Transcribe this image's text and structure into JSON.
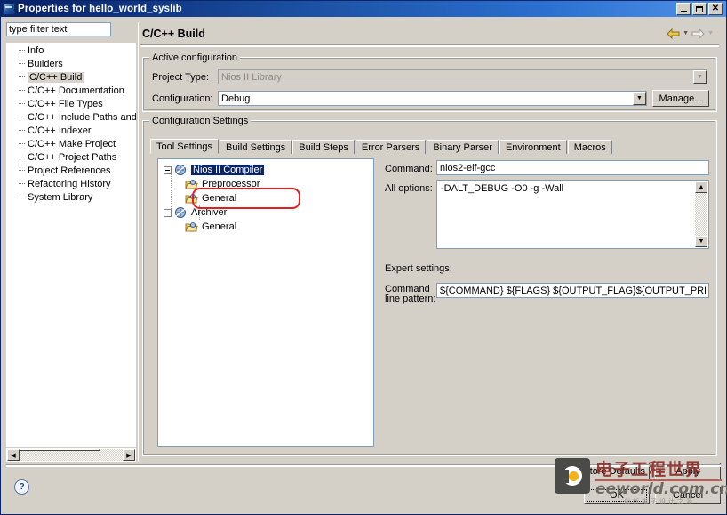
{
  "window": {
    "title": "Properties for hello_world_syslib",
    "icon": "properties-window-icon",
    "minimize": "_",
    "maximize": "□",
    "close": "✕"
  },
  "sidebar": {
    "filter": {
      "value": "type filter text",
      "placeholder": "type filter text"
    },
    "items": [
      {
        "label": "Info",
        "selected": false
      },
      {
        "label": "Builders",
        "selected": false
      },
      {
        "label": "C/C++ Build",
        "selected": true
      },
      {
        "label": "C/C++ Documentation",
        "selected": false
      },
      {
        "label": "C/C++ File Types",
        "selected": false
      },
      {
        "label": "C/C++ Include Paths and",
        "selected": false
      },
      {
        "label": "C/C++ Indexer",
        "selected": false
      },
      {
        "label": "C/C++ Make Project",
        "selected": false
      },
      {
        "label": "C/C++ Project Paths",
        "selected": false
      },
      {
        "label": "Project References",
        "selected": false
      },
      {
        "label": "Refactoring History",
        "selected": false
      },
      {
        "label": "System Library",
        "selected": false
      }
    ]
  },
  "page": {
    "title": "C/C++ Build",
    "nav": {
      "back_icon": "back-arrow-icon",
      "back_menu_icon": "chevron-down-icon",
      "forward_icon": "forward-arrow-icon",
      "forward_menu_icon": "chevron-down-icon"
    }
  },
  "active_configuration": {
    "group_title": "Active configuration",
    "project_type_label": "Project Type:",
    "project_type_value": "Nios II Library",
    "configuration_label": "Configuration:",
    "configuration_value": "Debug",
    "manage_button": "Manage..."
  },
  "configuration_settings": {
    "group_title": "Configuration Settings",
    "tabs": [
      {
        "label": "Tool Settings",
        "active": true
      },
      {
        "label": "Build Settings",
        "active": false
      },
      {
        "label": "Build Steps",
        "active": false
      },
      {
        "label": "Error Parsers",
        "active": false
      },
      {
        "label": "Binary Parser",
        "active": false
      },
      {
        "label": "Environment",
        "active": false
      },
      {
        "label": "Macros",
        "active": false
      }
    ],
    "tool_tree": [
      {
        "label": "Nios II Compiler",
        "level": 0,
        "icon": "tool-gear-icon",
        "expander": "minus",
        "selected": true,
        "highlighted": false
      },
      {
        "label": "Preprocessor",
        "level": 1,
        "icon": "folder-icon",
        "expander": "none",
        "selected": false,
        "highlighted": false
      },
      {
        "label": "General",
        "level": 1,
        "icon": "folder-icon",
        "expander": "none",
        "selected": false,
        "highlighted": true
      },
      {
        "label": "Archiver",
        "level": 0,
        "icon": "tool-gear-icon",
        "expander": "minus",
        "selected": false,
        "highlighted": false
      },
      {
        "label": "General",
        "level": 1,
        "icon": "folder-icon",
        "expander": "none",
        "selected": false,
        "highlighted": false
      }
    ],
    "command_label": "Command:",
    "command_value": "nios2-elf-gcc",
    "all_options_label": "All options:",
    "all_options_value": "-DALT_DEBUG -O0 -g -Wall",
    "expert_settings_label": "Expert settings:",
    "command_line_pattern_label_1": "Command",
    "command_line_pattern_label_2": "line pattern:",
    "command_line_pattern_value": "${COMMAND} ${FLAGS} ${OUTPUT_FLAG}${OUTPUT_PREFIX}${OU",
    "scroll_up_icon": "scroll-up-arrow-icon",
    "scroll_down_icon": "scroll-down-arrow-icon"
  },
  "footer": {
    "restore_defaults": "Restore Defaults",
    "apply": "Apply",
    "ok": "OK",
    "cancel": "Cancel",
    "help_icon": "help-question-icon"
  },
  "watermark": {
    "cn_text": "电子工程世界",
    "en_text": "eeworld.com.cn",
    "sub_text": "创新电子设计之源",
    "logo_icon": "eeworld-logo-icon"
  },
  "colors": {
    "title_bar": "#0a246a",
    "face": "#d4d0c8",
    "selection": "#0a246a",
    "highlight_box": "#e02020",
    "field": "#ffffff"
  }
}
